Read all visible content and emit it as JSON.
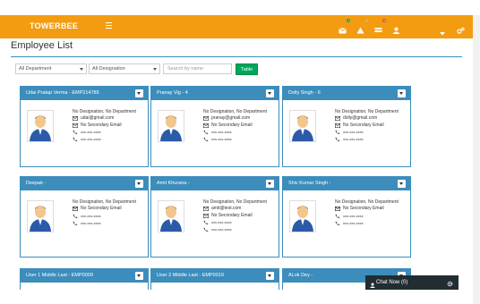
{
  "app": {
    "brand": "TOWERBEE"
  },
  "topbar": {
    "badges": {
      "messages": "4",
      "alerts": "1",
      "tasks": "9"
    },
    "colors": {
      "accent": "#f39c12",
      "primary": "#3c8dbc",
      "success": "#00a65a"
    }
  },
  "page": {
    "title": "Employee List"
  },
  "filters": {
    "department": "All Department",
    "designation": "All Designation",
    "search_placeholder": "Search by name",
    "table_view_label": "Table View"
  },
  "cards": [
    {
      "header": "Udai Pratap Verma - EMP214785",
      "designation": "No Designation, No Department",
      "email": "udai@gmail.com",
      "secondary_email": "No Secondary Email",
      "phone1": "xxx-xxx-xxxx",
      "phone2": "xxx-xxx-xxxx"
    },
    {
      "header": "Pranay Vig - 4",
      "designation": "No Designation, No Department",
      "email": "pranay@gmail.com",
      "secondary_email": "No Secondary Email",
      "phone1": "xxx-xxx-xxxx",
      "phone2": "xxx-xxx-xxxx"
    },
    {
      "header": "Dolly Singh - 6",
      "designation": "No Designation, No Department",
      "email": "dolly@gmail.com",
      "secondary_email": "No Secondary Email",
      "phone1": "xxx-xxx-xxxx",
      "phone2": "xxx-xxx-xxxx"
    },
    {
      "header": "Deepak -",
      "designation": "No Designation, No Department",
      "email": "",
      "secondary_email": "No Secondary Email",
      "phone1": "xxx-xxx-xxxx",
      "phone2": "xxx-xxx-xxxx"
    },
    {
      "header": "Amit Khurana -",
      "designation": "No Designation, No Department",
      "email": "amit@test.com",
      "secondary_email": "No Secondary Email",
      "phone1": "xxx-xxx-xxxx",
      "phone2": "xxx-xxx-xxxx"
    },
    {
      "header": "Shiv Kumar Singh -",
      "designation": "No Designation, No Department",
      "email": "",
      "secondary_email": "No Secondary Email",
      "phone1": "xxx-xxx-xxxx",
      "phone2": "xxx-xxx-xxxx"
    },
    {
      "header": "User 1 Middle Last - EMP0009"
    },
    {
      "header": "User 2 Middle Last - EMP0019"
    },
    {
      "header": "ALok Dey -"
    }
  ],
  "chat": {
    "label": "Chat Now (0)"
  }
}
